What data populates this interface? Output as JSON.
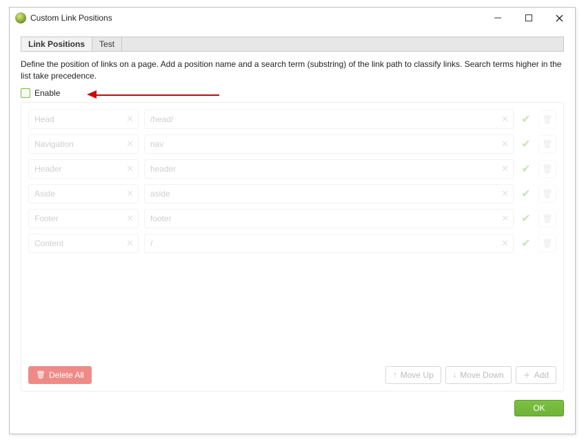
{
  "window": {
    "title": "Custom Link Positions",
    "icon": "globe-icon"
  },
  "tabs": [
    {
      "label": "Link Positions",
      "active": true
    },
    {
      "label": "Test",
      "active": false
    }
  ],
  "description": "Define the position of links on a page. Add a position name and a search term (substring) of the link path to classify links. Search terms higher in the list take precedence.",
  "enable": {
    "label": "Enable",
    "checked": false
  },
  "rows": [
    {
      "name": "Head",
      "term": "/head/"
    },
    {
      "name": "Navigation",
      "term": "nav"
    },
    {
      "name": "Header",
      "term": "header"
    },
    {
      "name": "Aside",
      "term": "aside"
    },
    {
      "name": "Footer",
      "term": "footer"
    },
    {
      "name": "Content",
      "term": "/"
    }
  ],
  "toolbar": {
    "delete_all": "Delete All",
    "move_up": "Move Up",
    "move_down": "Move Down",
    "add": "Add"
  },
  "footer": {
    "ok": "OK"
  }
}
